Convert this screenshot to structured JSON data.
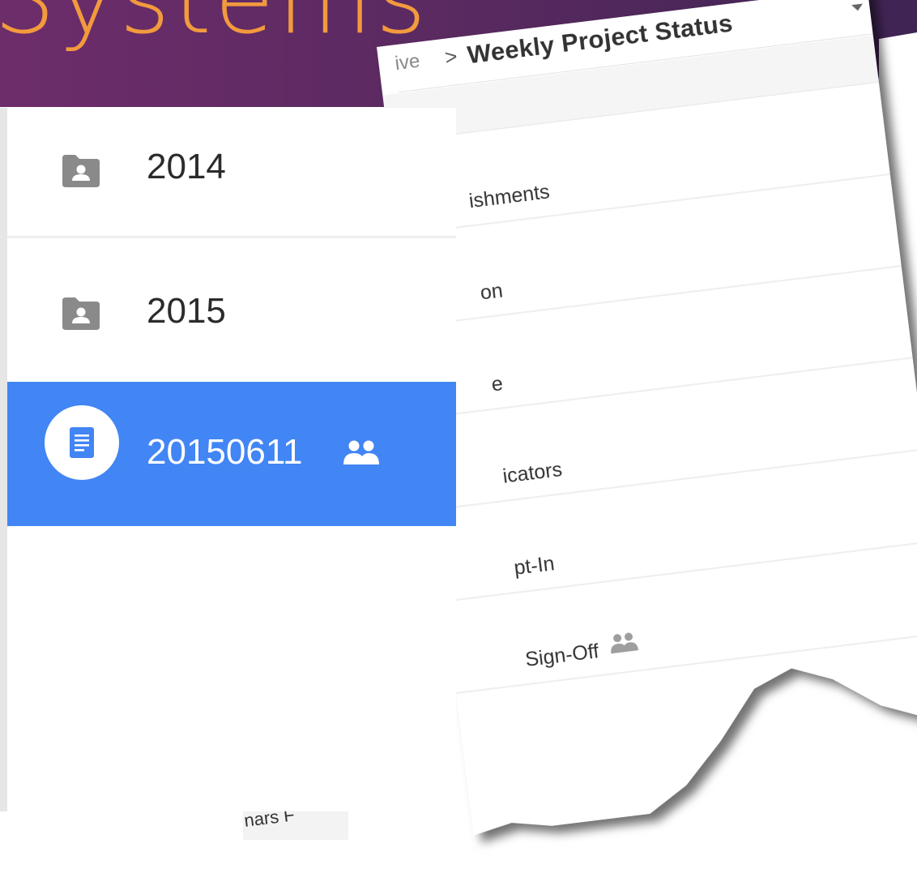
{
  "banner": {
    "title": "Systems"
  },
  "doc_page": {
    "breadcrumb_separator": ">",
    "breadcrumb_prefix": "ive",
    "title": "Weekly Project Status",
    "rows": [
      {
        "label": "ishments"
      },
      {
        "label": "on"
      },
      {
        "label": "e"
      },
      {
        "label": "icators"
      },
      {
        "label": "pt-In"
      },
      {
        "label": "Sign-Off",
        "shared": true
      }
    ]
  },
  "panel": {
    "items": [
      {
        "label": "2014",
        "icon": "shared-folder-icon"
      },
      {
        "label": "2015",
        "icon": "shared-folder-icon"
      },
      {
        "label": "20150611",
        "icon": "document-icon",
        "selected": true,
        "shared_icon": "people-icon"
      }
    ],
    "below_text": "nars F"
  },
  "colors": {
    "banner": "#5b2a62",
    "banner_text": "#f29a3d",
    "selected_row": "#4285f4"
  }
}
